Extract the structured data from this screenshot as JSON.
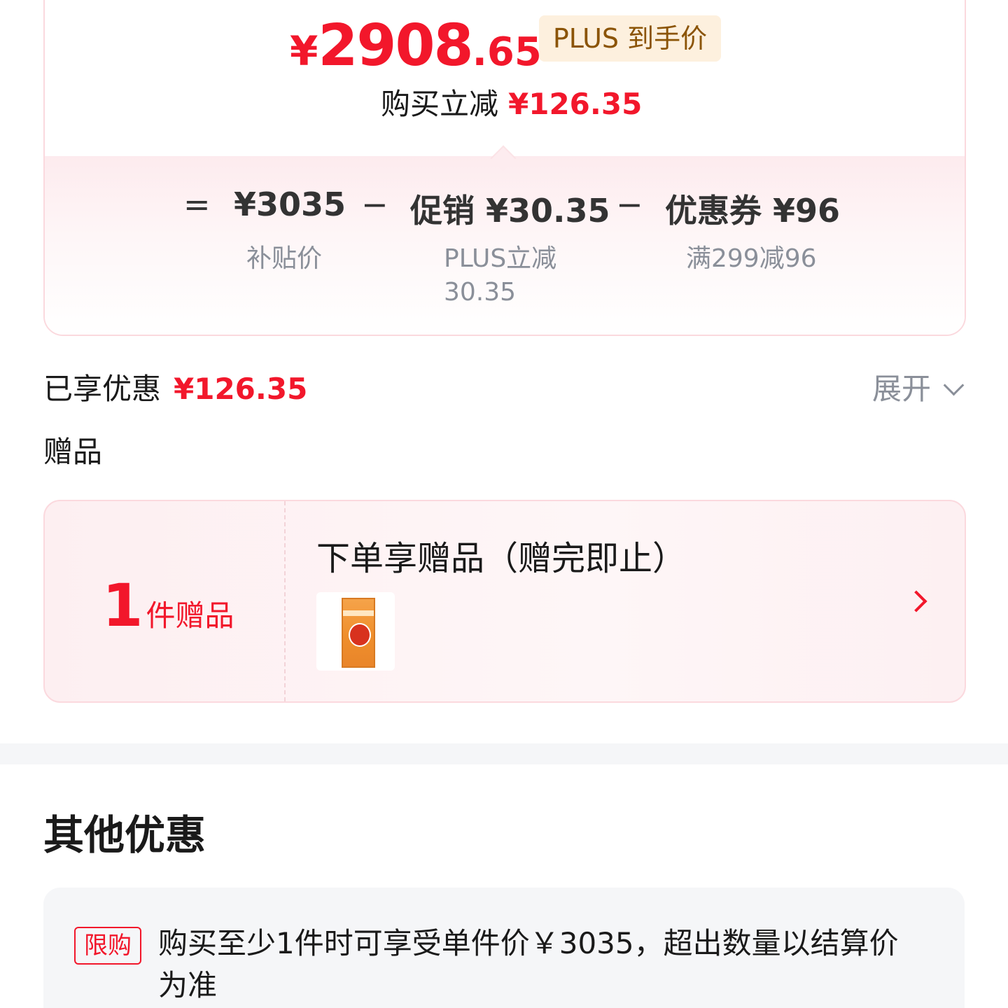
{
  "price_card": {
    "final_price": {
      "symbol": "¥",
      "integer": "2908",
      "decimal": ".65"
    },
    "plus_tag": "PLUS 到手价",
    "instant_cut_label": "购买立减",
    "instant_cut_amount": "¥126.35",
    "formula": {
      "equals": "=",
      "base_price": "¥3035",
      "base_label": "补贴价",
      "minus1": "−",
      "promo": "促销 ¥30.35",
      "promo_desc_line1": "PLUS立减",
      "promo_desc_line2": "30.35",
      "minus2": "−",
      "coupon": "优惠券 ¥96",
      "coupon_desc": "满299减96"
    }
  },
  "discount_summary": {
    "label": "已享优惠",
    "amount": "¥126.35",
    "expand_label": "展开"
  },
  "gift_section": {
    "label": "赠品",
    "count_number": "1",
    "count_unit": "件赠品",
    "title": "下单享赠品（赠完即止）"
  },
  "other_offers": {
    "title": "其他优惠",
    "limit_tag": "限购",
    "limit_text": "购买至少1件时可享受单件价￥3035，超出数量以结算价为准"
  },
  "colors": {
    "accent_red": "#f2172b",
    "plus_gold": "#8b5406",
    "muted_gray": "#8a8f99"
  }
}
